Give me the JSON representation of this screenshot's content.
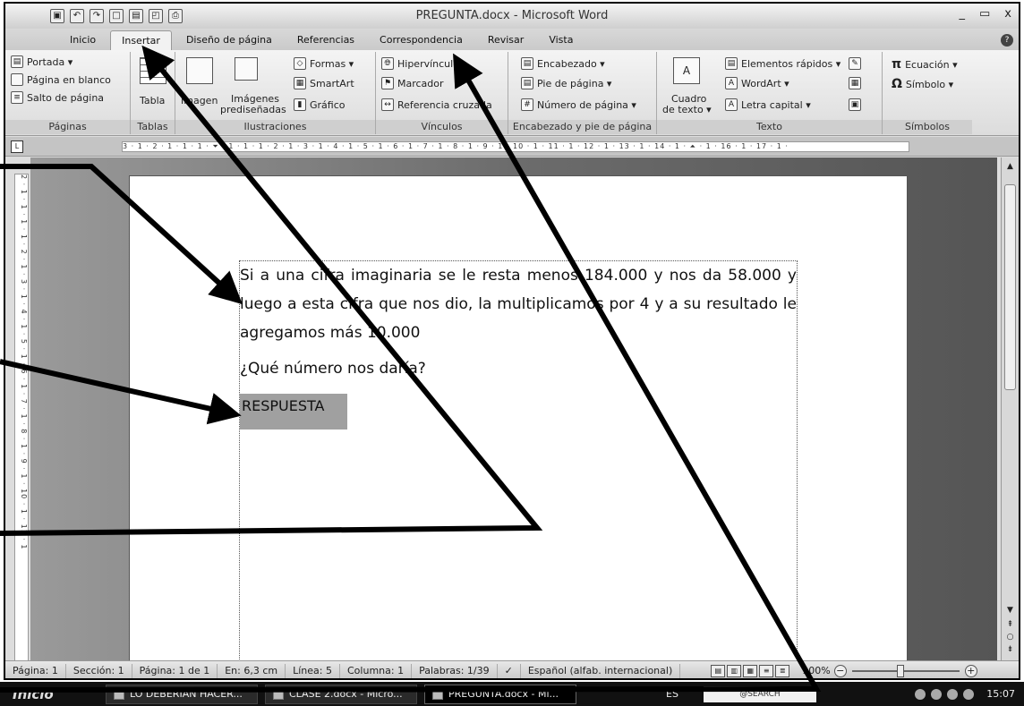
{
  "window": {
    "title": "PREGUNTA.docx - Microsoft Word",
    "office_button": "⊞",
    "controls": [
      "_",
      "▭",
      "x"
    ]
  },
  "qat": [
    "save-icon",
    "undo-icon",
    "redo-icon",
    "new-icon",
    "open-icon",
    "print-preview-icon",
    "print-icon"
  ],
  "tabs": [
    "Inicio",
    "Insertar",
    "Diseño de página",
    "Referencias",
    "Correspondencia",
    "Revisar",
    "Vista"
  ],
  "active_tab": "Insertar",
  "ribbon": {
    "paginas": {
      "label": "Páginas",
      "portada": "Portada ▾",
      "blanco": "Página en blanco",
      "salto": "Salto de página"
    },
    "tablas": {
      "label": "Tablas",
      "tabla": "Tabla"
    },
    "ilustraciones": {
      "label": "Ilustraciones",
      "imagen": "Imagen",
      "imagenes_a": "Imágenes",
      "imagenes_b": "prediseñadas",
      "formas": "Formas ▾",
      "smartart": "SmartArt",
      "grafico": "Gráfico"
    },
    "vinculos": {
      "label": "Vínculos",
      "hipervinculo": "Hipervínculo",
      "marcador": "Marcador",
      "referencia": "Referencia cruzada"
    },
    "encabezado": {
      "label": "Encabezado y pie de página",
      "encabezado": "Encabezado ▾",
      "pie": "Pie de página ▾",
      "numero": "Número de página ▾"
    },
    "texto": {
      "label": "Texto",
      "cuadro_a": "Cuadro",
      "cuadro_b": "de texto ▾",
      "elementos": "Elementos rápidos ▾",
      "wordart": "WordArt ▾",
      "letra": "Letra capital ▾"
    },
    "simbolos": {
      "label": "Símbolos",
      "ecuacion": "Ecuación ▾",
      "simbolo": "Símbolo ▾"
    }
  },
  "ruler": "3 · 1 · 2 · 1 · 1 · 1 · ⏷ · 1 · 1 · 1 · 2 · 1 · 3 · 1 · 4 · 1 · 5 · 1 · 6 · 1 · 7 · 1 · 8 · 1 · 9 · 1 · 10 · 1 · 11 · 1 · 12 · 1 · 13 · 1 · 14 · 1 · ⏶ · 1 · 16 · 1 · 17 · 1 ·",
  "vruler": "2 · 1 · 1 · 1 · 1 · 2 · 1 · 3 · 1 · 4 · 1 · 5 · 1 · 6 · 1 · 7 · 1 · 8 · 1 · 9 · 1 · 10 · 1 · 11 · 1",
  "document": {
    "paragraph": "Si a una cifra imaginaria se le resta menos 184.000 y nos da 58.000 y luego a esta cifra que nos dio, la multiplicamos por 4 y a su resultado le agregamos más 10.000",
    "question": "¿Qué número nos daría?",
    "answer_box": "RESPUESTA"
  },
  "statusbar": {
    "pagina": "Página: 1",
    "seccion": "Sección: 1",
    "pagina_de": "Página: 1 de 1",
    "en": "En: 6,3 cm",
    "linea": "Línea: 5",
    "columna": "Columna: 1",
    "palabras": "Palabras: 1/39",
    "idioma": "Español (alfab. internacional)",
    "zoom": "100%"
  },
  "taskbar": {
    "start": "Inicio",
    "tasks": [
      "LO DEBERIAN HACER...",
      "CLASE 2.docx - Micro...",
      "PREGUNTA.docx - Mi..."
    ],
    "lang": "ES",
    "search": "@SEARCH",
    "clock": "15:07"
  },
  "colors": {
    "answer_box": "#a0a0a0",
    "arrows": "#000000"
  }
}
